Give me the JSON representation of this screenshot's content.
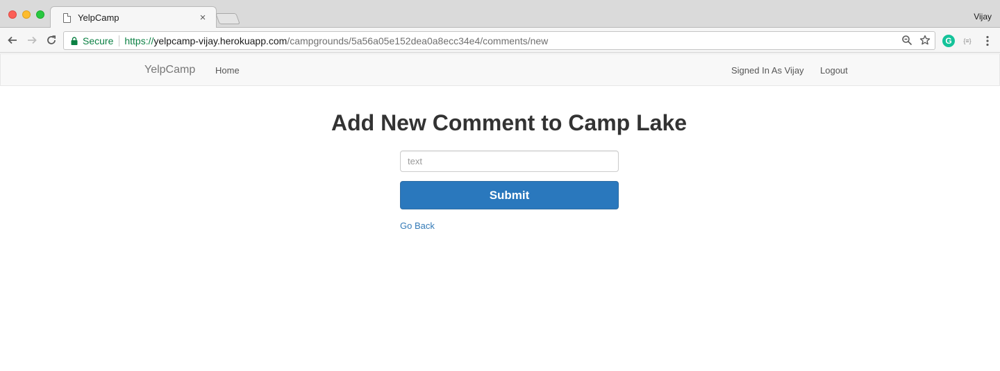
{
  "browser": {
    "tab_title": "YelpCamp",
    "tab_close": "×",
    "profile_name": "Vijay",
    "secure_label": "Secure",
    "url_scheme": "https://",
    "url_host": "yelpcamp-vijay.herokuapp.com",
    "url_path": "/campgrounds/5a56a05e152dea0a8ecc34e4/comments/new",
    "grammarly_letter": "G",
    "jsonview_label": "{≡}"
  },
  "navbar": {
    "brand": "YelpCamp",
    "home": "Home",
    "signed_in": "Signed In As Vijay",
    "logout": "Logout"
  },
  "form": {
    "title": "Add New Comment to Camp Lake",
    "text_value": "",
    "text_placeholder": "text",
    "submit_label": "Submit",
    "go_back": "Go Back"
  },
  "colors": {
    "primary_button": "#2a78bd",
    "link": "#337ab7",
    "secure_green": "#0b8043",
    "navbar_bg": "#f8f8f8"
  }
}
